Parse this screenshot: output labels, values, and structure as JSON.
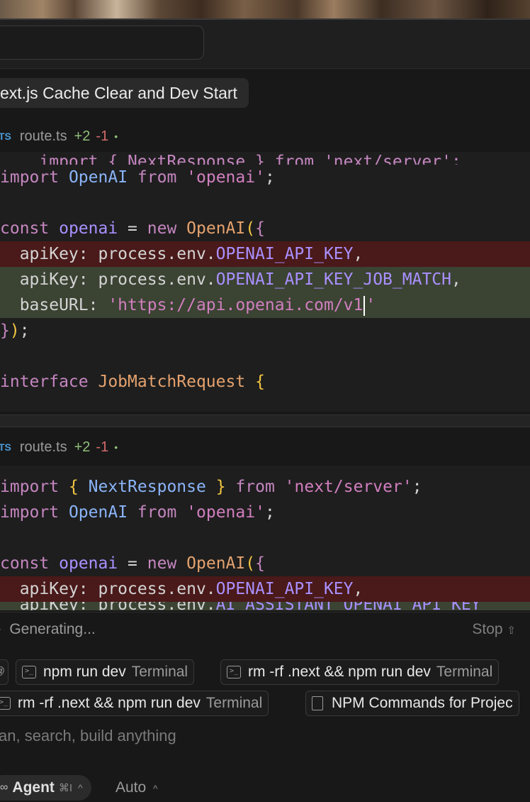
{
  "chat": {
    "title": "ext.js Cache Clear and Dev Start"
  },
  "diff_panels": [
    {
      "file_badge": "TS",
      "file_name": "route.ts",
      "additions": "+2",
      "deletions": "-1",
      "status_dot": "•"
    },
    {
      "file_badge": "TS",
      "file_name": "route.ts",
      "additions": "+2",
      "deletions": "-1",
      "status_dot": "•"
    }
  ],
  "code1": {
    "l0": "import { NextResponse } from 'next/server';",
    "l1a": "import",
    "l1b": "OpenAI",
    "l1c": "from",
    "l1d": "'openai'",
    "l1e": ";",
    "l3a": "const",
    "l3b": "openai",
    "l3c": " = ",
    "l3d": "new",
    "l3e": "OpenAI",
    "l3f": "(",
    "l3g": "{",
    "l4a": "  apiKey: process.env.",
    "l4b": "OPENAI_API_KEY",
    "l4c": ",",
    "l5a": "  apiKey: process.env.",
    "l5b": "OPENAI_API_KEY_JOB_MATCH",
    "l5c": ",",
    "l6a": "  baseURL: ",
    "l6b": "'https://api.openai.com/v1",
    "l6c": "'",
    "l7a": "}",
    "l7b": ")",
    "l7c": ";",
    "l9a": "interface",
    "l9b": "JobMatchRequest",
    "l9c": "{"
  },
  "code2": {
    "l0a": "import",
    "l0b": "{",
    "l0c": "NextResponse",
    "l0d": "}",
    "l0e": "from",
    "l0f": "'next/server'",
    "l0g": ";",
    "l1a": "import",
    "l1b": "OpenAI",
    "l1c": "from",
    "l1d": "'openai'",
    "l1e": ";",
    "l3a": "const",
    "l3b": "openai",
    "l3c": " = ",
    "l3d": "new",
    "l3e": "OpenAI",
    "l3f": "(",
    "l3g": "{",
    "l4a": "  apiKey: process.env.",
    "l4b": "OPENAI_API_KEY",
    "l4c": ",",
    "l5a": "  apiKey: process.env.",
    "l5b": "AI_ASSISTANT_OPENAI_API_KEY"
  },
  "status": {
    "generating": "Generating...",
    "stop": "Stop"
  },
  "context_pills": [
    {
      "label": "npm run dev",
      "sub": "Terminal"
    },
    {
      "label": "rm -rf .next && npm run dev",
      "sub": "Terminal"
    },
    {
      "label": "rm -rf .next && npm run dev",
      "sub": "Terminal"
    },
    {
      "label": "NPM Commands for Projec",
      "sub": ""
    }
  ],
  "input": {
    "placeholder": "an, search, build anything"
  },
  "mode": {
    "agent_label": "Agent",
    "agent_shortcut": "⌘I",
    "model_label": "Auto"
  }
}
